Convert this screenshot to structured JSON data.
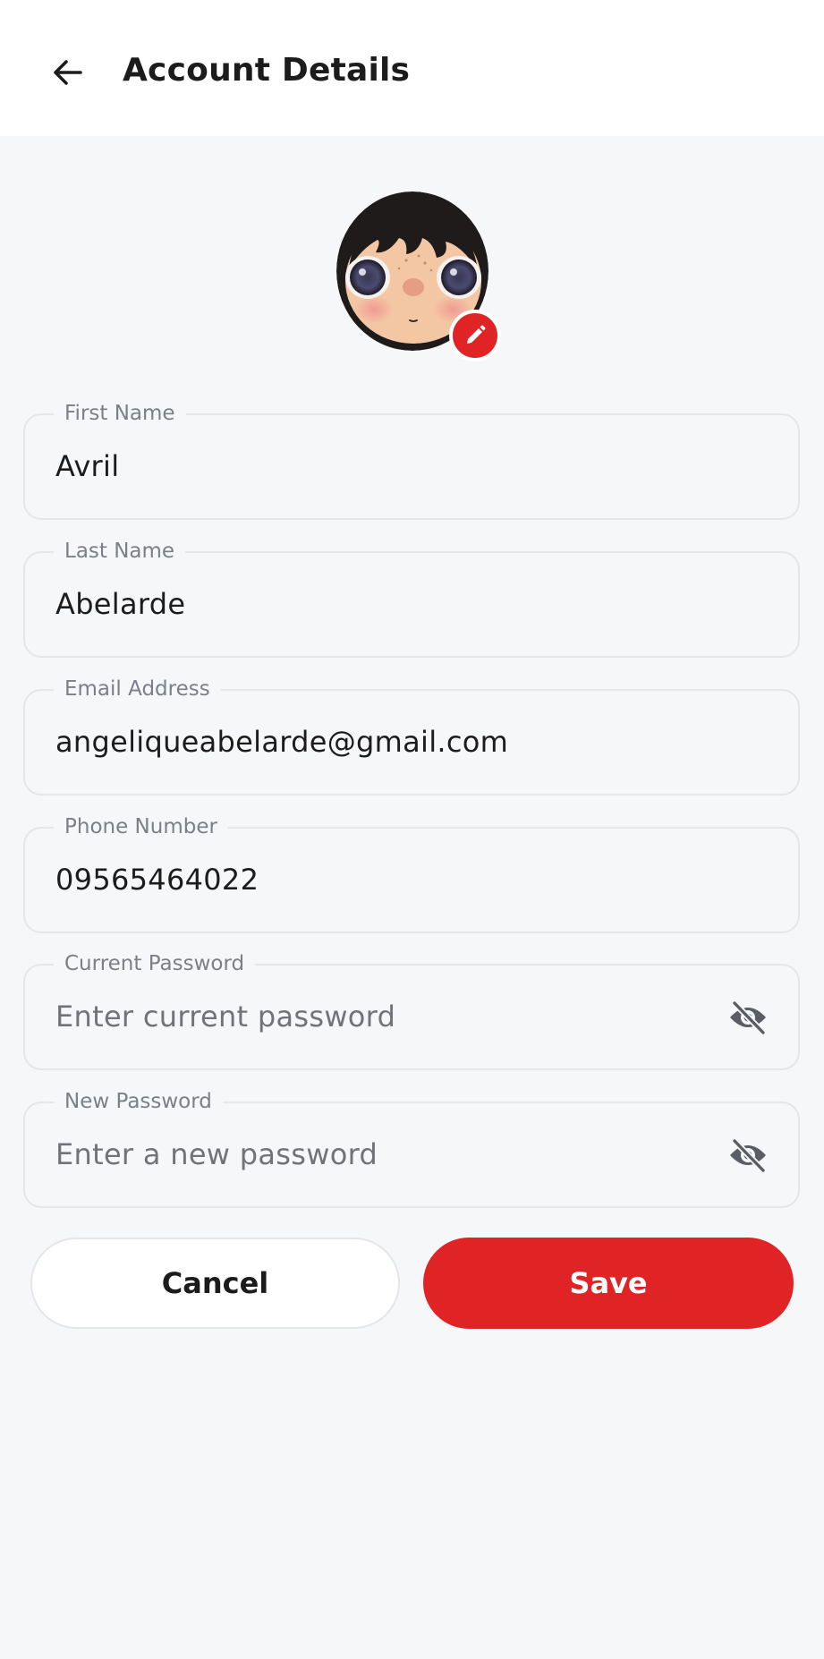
{
  "header": {
    "title": "Account Details",
    "back_icon": "arrow-left-icon"
  },
  "avatar": {
    "edit_icon": "pencil-icon",
    "edit_button_color": "#e02426"
  },
  "form": {
    "fields": [
      {
        "label": "First Name",
        "value": "Avril"
      },
      {
        "label": "Last Name",
        "value": "Abelarde"
      },
      {
        "label": "Email Address",
        "value": "angeliqueabelarde@gmail.com"
      },
      {
        "label": "Phone Number",
        "value": "09565464022"
      },
      {
        "label": "Current Password",
        "value": "",
        "placeholder": "Enter current password",
        "icon": "eye-off-icon"
      },
      {
        "label": "New Password",
        "value": "",
        "placeholder": "Enter a new password",
        "icon": "eye-off-icon"
      }
    ]
  },
  "actions": {
    "cancel_label": "Cancel",
    "save_label": "Save",
    "accent_color": "#e02426"
  }
}
